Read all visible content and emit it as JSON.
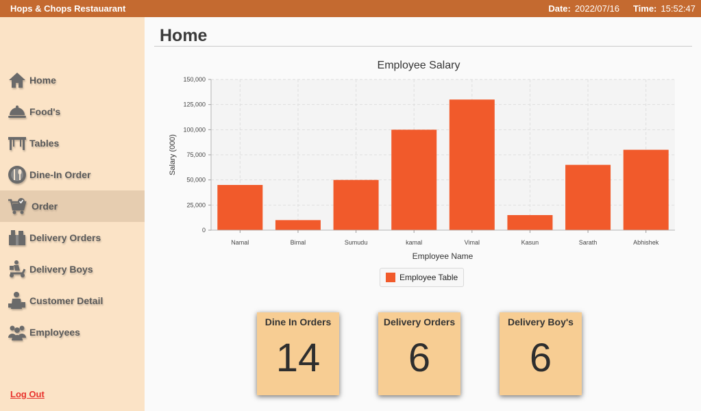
{
  "window": {
    "app_title": "Hops & Chops Restauarant",
    "date_label": "Date:",
    "date_value": "2022/07/16",
    "time_label": "Time:",
    "time_value": "15:52:47"
  },
  "sidebar": {
    "items": [
      {
        "label": "Home",
        "icon": "home-icon"
      },
      {
        "label": "Food's",
        "icon": "food-cloche-icon"
      },
      {
        "label": "Tables",
        "icon": "table-icon"
      },
      {
        "label": "Dine-In Order",
        "icon": "dine-in-plate-icon"
      },
      {
        "label": "Order",
        "icon": "cart-icon",
        "active": true
      },
      {
        "label": "Delivery Orders",
        "icon": "delivery-box-icon"
      },
      {
        "label": "Delivery Boys",
        "icon": "scooter-icon"
      },
      {
        "label": "Customer Detail",
        "icon": "customer-icon"
      },
      {
        "label": "Employees",
        "icon": "employees-icon"
      }
    ],
    "logout_label": "Log Out"
  },
  "main": {
    "page_title": "Home"
  },
  "chart_data": {
    "type": "bar",
    "title": "Employee Salary",
    "xlabel": "Employee Name",
    "ylabel": "Salary (000)",
    "categories": [
      "Namal",
      "Bimal",
      "Sumudu",
      "kamal",
      "Vimal",
      "Kasun",
      "Sarath",
      "Abhishek"
    ],
    "series": [
      {
        "name": "Employee Table",
        "values": [
          45000,
          10000,
          50000,
          100000,
          130000,
          15000,
          65000,
          80000
        ],
        "color": "#f15a2b"
      }
    ],
    "ylim": [
      0,
      150000
    ],
    "yticks": [
      "0",
      "25,000",
      "50,000",
      "75,000",
      "100,000",
      "125,000",
      "150,000"
    ],
    "grid": true,
    "legend_position": "bottom"
  },
  "stats": [
    {
      "label": "Dine In Orders",
      "value": "14"
    },
    {
      "label": "Delivery Orders",
      "value": "6"
    },
    {
      "label": "Delivery Boy's",
      "value": "6"
    }
  ],
  "colors": {
    "titlebar": "#c46a30",
    "sidebar": "#fbe3c6",
    "active_nav": "#e6cdb0",
    "bar": "#f15a2b",
    "card": "#f7cd93",
    "logout": "#e8322c"
  }
}
